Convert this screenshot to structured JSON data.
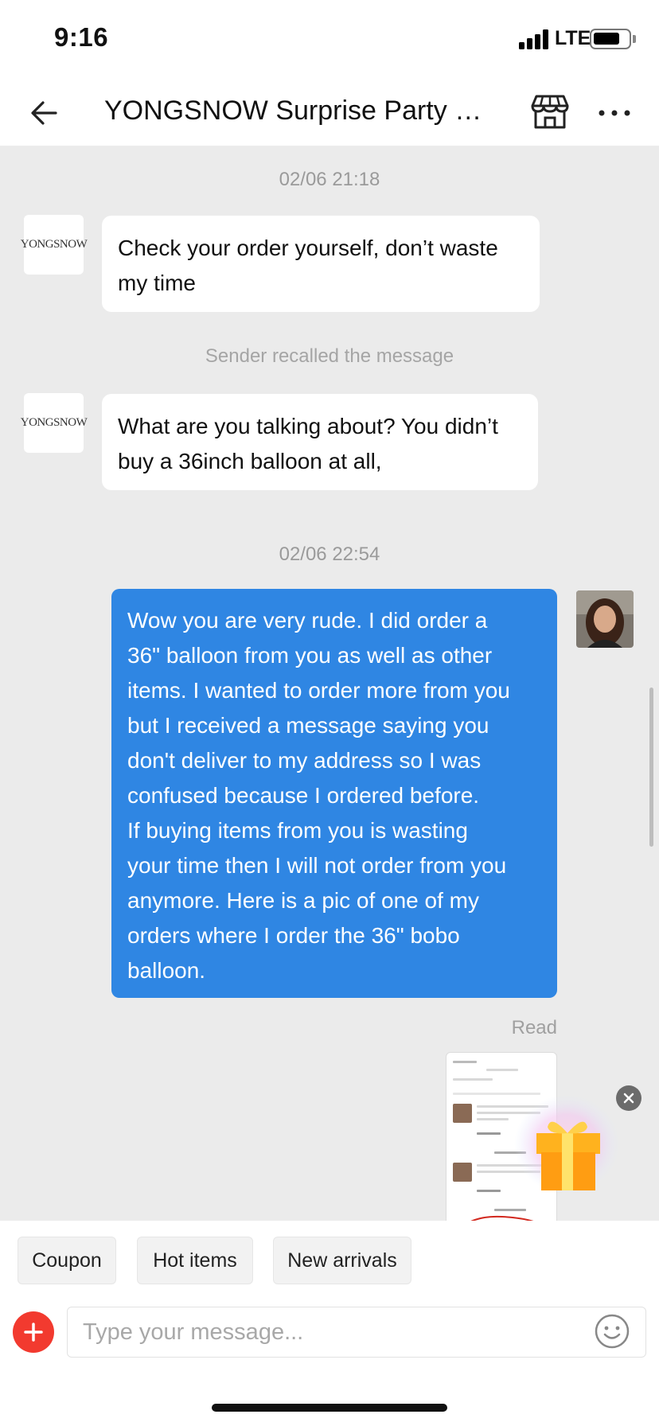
{
  "status_bar": {
    "time": "9:16",
    "network": "LTE"
  },
  "header": {
    "title": "YONGSNOW Surprise Party St...",
    "back_icon": "arrow-left-icon",
    "store_icon": "store-icon",
    "more_icon": "more-horizontal-icon"
  },
  "conversation": {
    "seller_avatar_text": "YONGSNOW",
    "timestamps": [
      "02/06 21:18",
      "02/06 22:54"
    ],
    "system_note": "Sender recalled the message",
    "incoming": [
      {
        "lines": [
          "Check your order yourself, don’t waste",
          "my time"
        ]
      },
      {
        "lines": [
          "What are you talking about? You didn’t",
          "buy a 36inch balloon at all,"
        ]
      }
    ],
    "outgoing": {
      "lines": [
        "Wow you are very rude. I did order a",
        "36\" balloon from you as well as other",
        "items. I wanted to order more from you",
        "but I received a message saying you",
        "don't deliver to my address so I was",
        "confused because I ordered before.",
        "If buying items from you is wasting",
        "your time then I will not order from you",
        "anymore.  Here is a pic of one of my",
        "orders where I order the 36\" bobo",
        "balloon."
      ],
      "status": "Read"
    }
  },
  "quick_replies": [
    "Coupon",
    "Hot items",
    "New arrivals"
  ],
  "composer": {
    "placeholder": "Type your message...",
    "plus_icon": "plus-icon",
    "emoji_icon": "emoji-icon"
  },
  "colors": {
    "outgoing_bubble": "#2f86e3",
    "chat_background": "#ebebeb",
    "plus_button": "#f23a2f"
  }
}
